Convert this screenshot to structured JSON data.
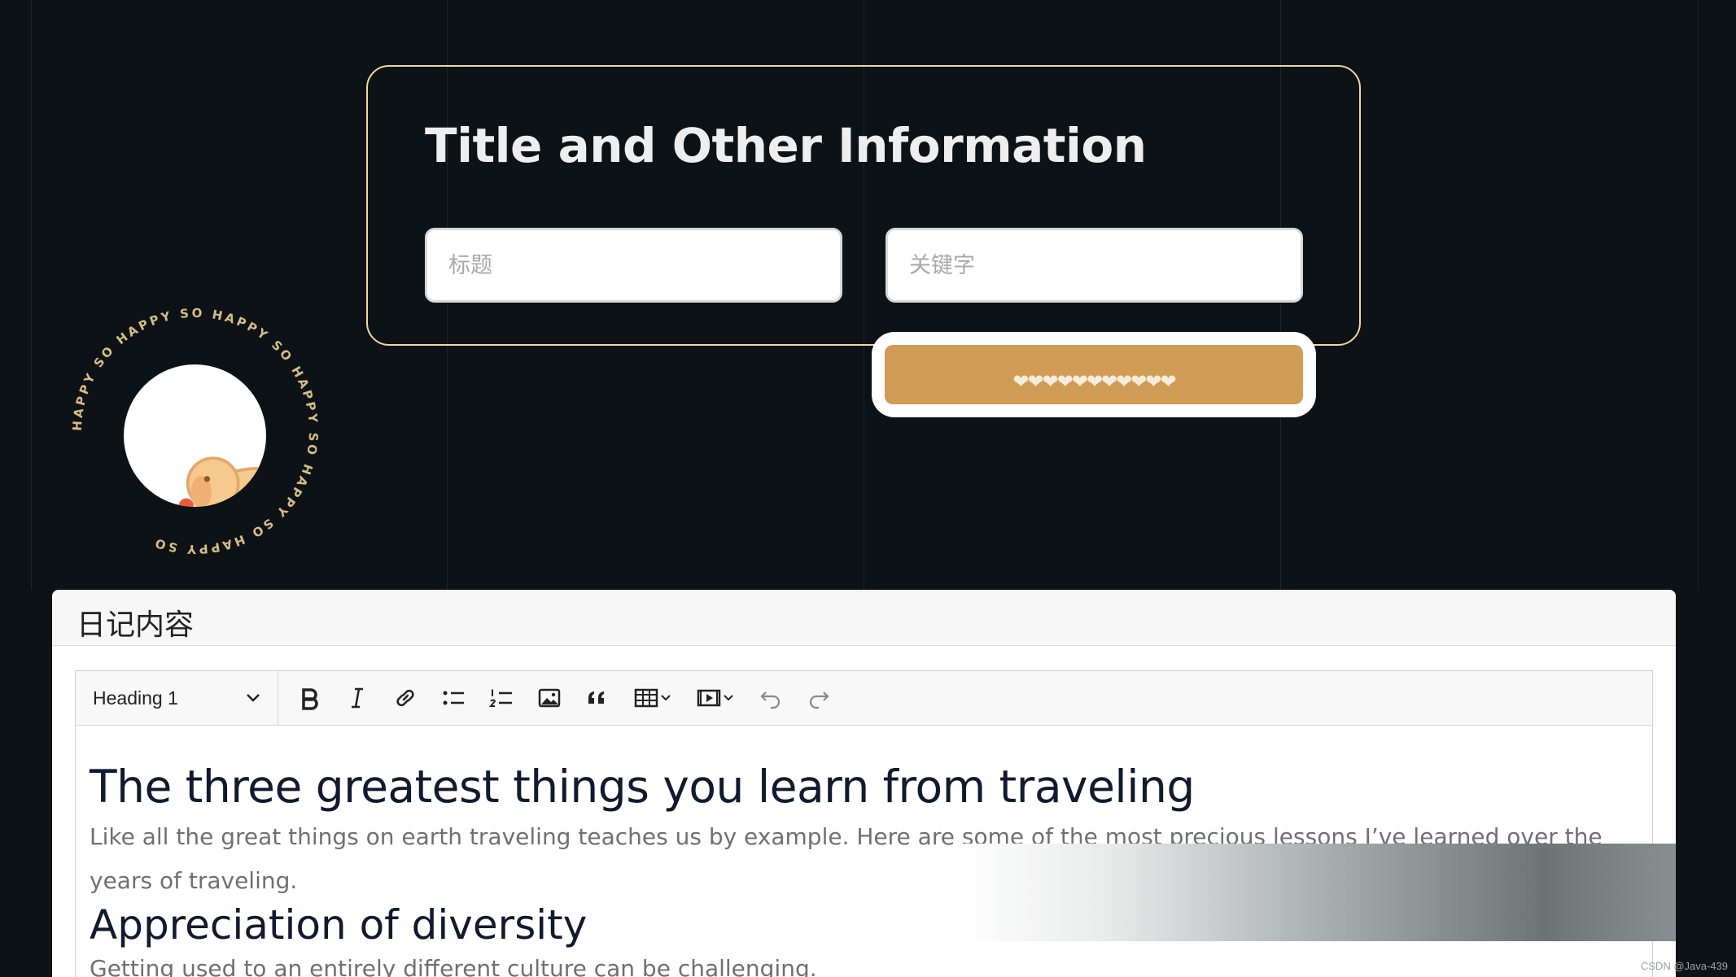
{
  "info_card": {
    "title": "Title and Other Information",
    "title_placeholder": "标题",
    "keyword_placeholder": "关键字",
    "submit_label": "❤❤❤❤❤❤❤❤❤❤❤"
  },
  "badge": {
    "ring_text": "HAPPY SO HAPPY SO HAPPY SO HAPPY SO HAPPY SO HAPPY SO",
    "accent_color": "#d7bd82"
  },
  "editor": {
    "card_title": "日记内容",
    "heading_select": "Heading 1",
    "toolbar_icons": [
      "bold-icon",
      "italic-icon",
      "link-icon",
      "bulleted-list-icon",
      "numbered-list-icon",
      "image-icon",
      "quote-icon",
      "table-icon",
      "media-icon",
      "undo-icon",
      "redo-icon"
    ],
    "content": {
      "h1": "The three greatest things you learn from traveling",
      "p1": "Like all the great things on earth traveling teaches us by example. Here are some of the most precious lessons I’ve learned over the years of traveling.",
      "h2": "Appreciation of diversity",
      "p2": "Getting used to an entirely different culture can be challenging."
    }
  },
  "watermark": "CSDN @Java-439",
  "colors": {
    "background": "#0c1215",
    "card_border": "#f1d89f",
    "button": "#d09b54"
  }
}
